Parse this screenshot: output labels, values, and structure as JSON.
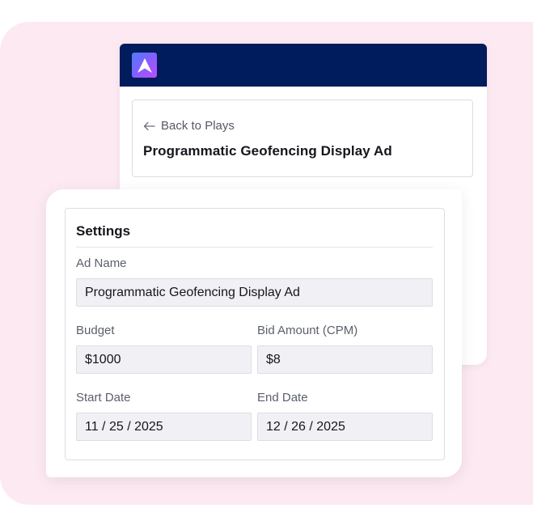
{
  "header": {
    "back_label": "Back to Plays",
    "play_title": "Programmatic Geofencing Display Ad"
  },
  "settings": {
    "title": "Settings",
    "ad_name": {
      "label": "Ad Name",
      "value": "Programmatic Geofencing Display Ad"
    },
    "budget": {
      "label": "Budget",
      "value": "$1000"
    },
    "bid_amount": {
      "label": "Bid Amount (CPM)",
      "value": "$8"
    },
    "start_date": {
      "label": "Start Date",
      "value": "11 / 25 / 2025"
    },
    "end_date": {
      "label": "End Date",
      "value": "12 / 26 / 2025"
    }
  },
  "colors": {
    "topbar": "#001c5c",
    "background": "#fde9f2",
    "field_bg": "#f1f1f5"
  },
  "icons": {
    "logo": "app-logo-icon",
    "back": "arrow-left-icon"
  }
}
